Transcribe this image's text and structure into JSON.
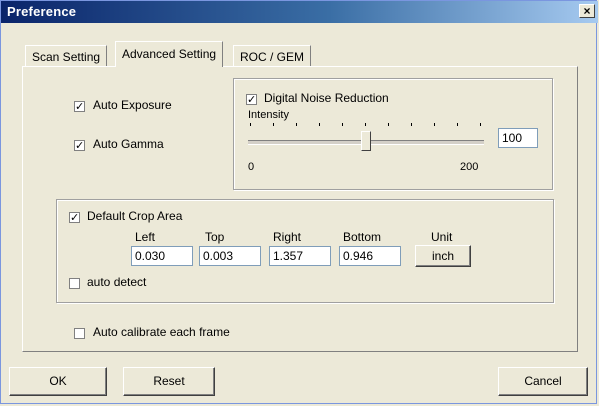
{
  "window": {
    "title": "Preference",
    "close_glyph": "×",
    "close_icon": "close-icon"
  },
  "tabs": [
    {
      "label": "Scan Setting",
      "active": false
    },
    {
      "label": "Advanced Setting",
      "active": true
    },
    {
      "label": "ROC / GEM",
      "active": false
    }
  ],
  "auto_exposure": {
    "label": "Auto Exposure",
    "checked": true
  },
  "auto_gamma": {
    "label": "Auto Gamma",
    "checked": true
  },
  "noise": {
    "label": "Digital Noise Reduction",
    "checked": true,
    "intensity_label": "Intensity",
    "min_label": "0",
    "max_label": "200",
    "value": "100",
    "slider_fraction": 0.5
  },
  "crop": {
    "label": "Default Crop Area",
    "checked": true,
    "columns": {
      "left": "Left",
      "top": "Top",
      "right": "Right",
      "bottom": "Bottom",
      "unit": "Unit"
    },
    "values": {
      "left": "0.030",
      "top": "0.003",
      "right": "1.357",
      "bottom": "0.946"
    },
    "unit_button": "inch",
    "auto_detect": {
      "label": "auto detect",
      "checked": false
    }
  },
  "auto_calibrate": {
    "label": "Auto calibrate each frame",
    "checked": false
  },
  "buttons": {
    "ok": "OK",
    "reset": "Reset",
    "cancel": "Cancel"
  },
  "check_glyph": "✓"
}
